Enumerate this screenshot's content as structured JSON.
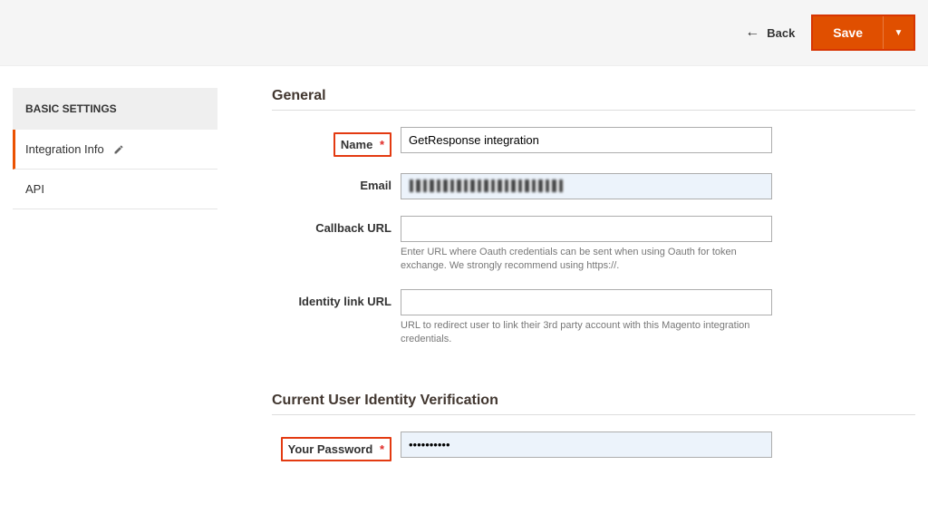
{
  "topbar": {
    "back_label": "Back",
    "save_label": "Save"
  },
  "sidebar": {
    "heading": "BASIC SETTINGS",
    "items": [
      {
        "label": "Integration Info",
        "active": true,
        "editable": true
      },
      {
        "label": "API",
        "active": false,
        "editable": false
      }
    ]
  },
  "sections": {
    "general": {
      "title": "General",
      "name_label": "Name",
      "name_value": "GetResponse integration",
      "email_label": "Email",
      "email_value": "",
      "callback_label": "Callback URL",
      "callback_value": "",
      "callback_hint": "Enter URL where Oauth credentials can be sent when using Oauth for token exchange. We strongly recommend using https://.",
      "identity_label": "Identity link URL",
      "identity_value": "",
      "identity_hint": "URL to redirect user to link their 3rd party account with this Magento integration credentials."
    },
    "verify": {
      "title": "Current User Identity Verification",
      "password_label": "Your Password",
      "password_value": "••••••••••"
    }
  },
  "colors": {
    "accent": "#eb5202",
    "highlight_border": "#e33a11"
  }
}
